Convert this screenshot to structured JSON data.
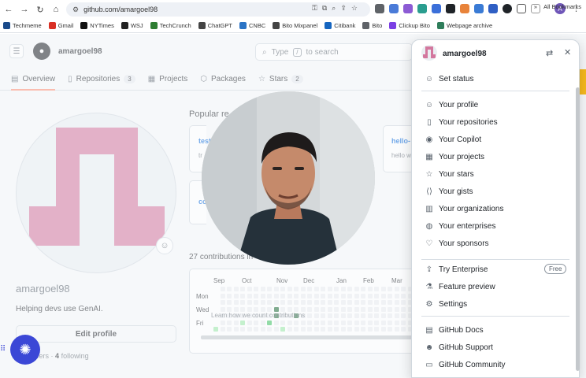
{
  "browser": {
    "url": "github.com/amargoel98",
    "bookmarks": [
      "Techmeme",
      "Gmail",
      "NYTimes",
      "WSJ",
      "TechCrunch",
      "ChatGPT",
      "CNBC",
      "Bito Mixpanel",
      "Citibank",
      "Bito",
      "Clickup Bito",
      "Webpage archive"
    ],
    "all_bookmarks": "All Bookmarks",
    "avatar_initial": "A"
  },
  "header": {
    "username": "amargoel98",
    "search_placeholder_prefix": "Type",
    "search_slash": "/",
    "search_placeholder_suffix": "to search"
  },
  "tabs": [
    {
      "label": "Overview",
      "count": ""
    },
    {
      "label": "Repositories",
      "count": "3"
    },
    {
      "label": "Projects",
      "count": ""
    },
    {
      "label": "Packages",
      "count": ""
    },
    {
      "label": "Stars",
      "count": "2"
    }
  ],
  "profile": {
    "username": "amargoel98",
    "bio": "Helping devs use GenAI.",
    "edit_label": "Edit profile",
    "followers_suffix": "llowers",
    "following_count": "4",
    "following_label": "following"
  },
  "popular": {
    "title": "Popular re",
    "repos": [
      {
        "name": "test",
        "desc": "tr"
      },
      {
        "name": "hello-",
        "desc": "hello w"
      },
      {
        "name": "co",
        "desc": ""
      }
    ]
  },
  "contributions": {
    "title": "27 contributions in",
    "months": [
      "Sep",
      "Oct",
      "Nov",
      "Dec",
      "Jan",
      "Feb",
      "Mar"
    ],
    "days": [
      "Mon",
      "Wed",
      "Fri"
    ],
    "learn": "Learn how we count contributions"
  },
  "panel": {
    "username": "amargoel98",
    "set_status": "Set status",
    "group1": [
      "Your profile",
      "Your repositories",
      "Your Copilot",
      "Your projects",
      "Your stars",
      "Your gists",
      "Your organizations",
      "Your enterprises",
      "Your sponsors"
    ],
    "group2": [
      "Try Enterprise",
      "Feature preview",
      "Settings"
    ],
    "free_badge": "Free",
    "group3": [
      "GitHub Docs",
      "GitHub Support",
      "GitHub Community"
    ]
  },
  "colors": {
    "accent": "#0969da",
    "tab_underline": "#fd8c73",
    "logo_pink": "#d3779e",
    "ext_tab": "#f6b91d",
    "floating_btn": "#3b47d6"
  }
}
